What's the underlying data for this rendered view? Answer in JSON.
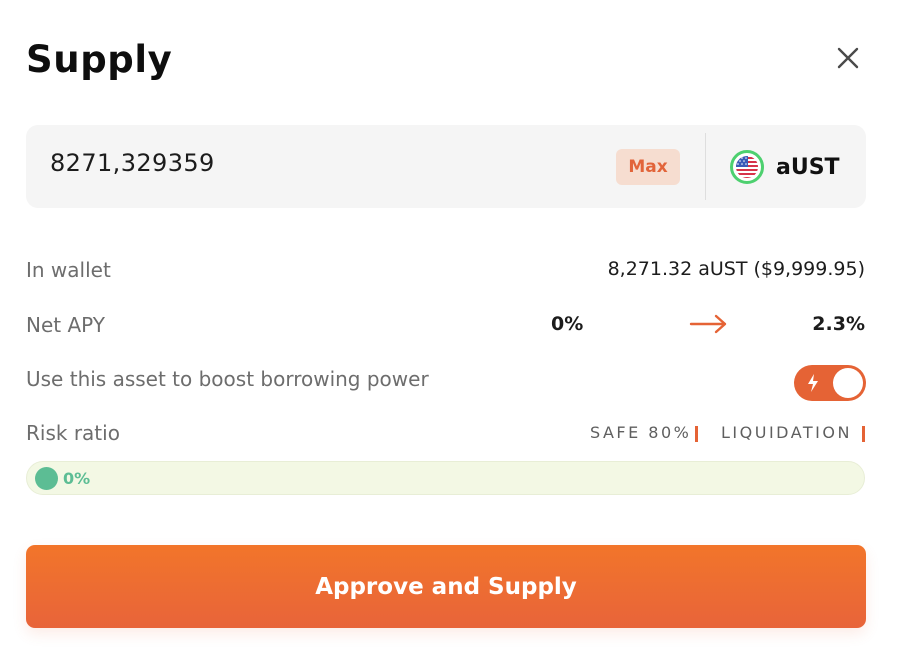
{
  "modal": {
    "title": "Supply",
    "close_icon": "close-icon"
  },
  "amount_input": {
    "value": "8271,329359",
    "max_label": "Max"
  },
  "token": {
    "symbol": "aUST",
    "icon": "us-flag-icon"
  },
  "details": {
    "in_wallet_label": "In wallet",
    "in_wallet_value": "8,271.32 aUST ($9,999.95)",
    "net_apy_label": "Net APY",
    "net_apy_from": "0%",
    "net_apy_to": "2.3%",
    "collateral_label": "Use this asset to boost borrowing power",
    "collateral_enabled": true,
    "risk_label": "Risk ratio",
    "safe_label": "SAFE 80%",
    "liquidation_label": "LIQUIDATION",
    "risk_value": "0%",
    "risk_fraction": 0.0
  },
  "cta": {
    "label": "Approve and Supply"
  },
  "colors": {
    "accent": "#e56335",
    "safe_green": "#5cbd94",
    "token_ring": "#4dd06f"
  }
}
